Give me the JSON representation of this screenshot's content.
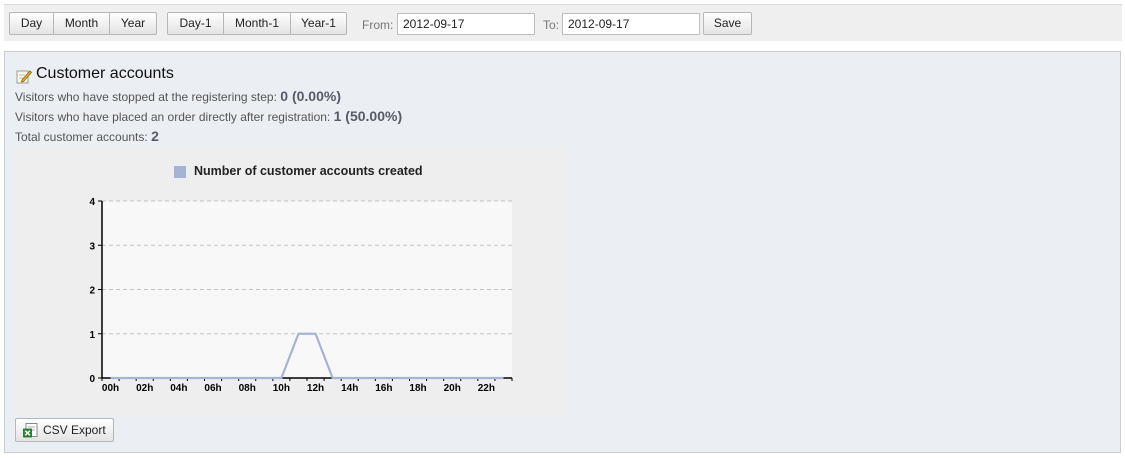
{
  "toolbar": {
    "period_buttons": [
      "Day",
      "Month",
      "Year"
    ],
    "previous_buttons": [
      "Day-1",
      "Month-1",
      "Year-1"
    ],
    "from_label": "From:",
    "from_value": "2012-09-17",
    "to_label": "To:",
    "to_value": "2012-09-17",
    "save_label": "Save"
  },
  "panel": {
    "title": "Customer accounts",
    "title_icon": "edit-icon",
    "stats": [
      {
        "label": "Visitors who have stopped at the registering step:",
        "value": "0 (0.00%)"
      },
      {
        "label": "Visitors who have placed an order directly after registration:",
        "value": "1 (50.00%)"
      },
      {
        "label": "Total customer accounts:",
        "value": "2"
      }
    ],
    "csv_export_label": "CSV Export",
    "csv_icon": "excel-icon"
  },
  "chart_data": {
    "type": "line",
    "title": "",
    "legend_position": "top",
    "grid": true,
    "ylim": [
      0,
      4
    ],
    "yticks": [
      "0",
      "1",
      "2",
      "3",
      "4"
    ],
    "xticks": [
      "00h",
      "02h",
      "04h",
      "06h",
      "08h",
      "10h",
      "12h",
      "14h",
      "16h",
      "18h",
      "20h",
      "22h"
    ],
    "x": [
      0,
      1,
      2,
      3,
      4,
      5,
      6,
      7,
      8,
      9,
      10,
      11,
      12,
      13,
      14,
      15,
      16,
      17,
      18,
      19,
      20,
      21,
      22,
      23
    ],
    "series": [
      {
        "name": "Number of customer accounts created",
        "color": "#a6b4d3",
        "values": [
          0,
          0,
          0,
          0,
          0,
          0,
          0,
          0,
          0,
          0,
          0,
          1,
          1,
          0,
          0,
          0,
          0,
          0,
          0,
          0,
          0,
          0,
          0,
          0
        ]
      }
    ]
  }
}
